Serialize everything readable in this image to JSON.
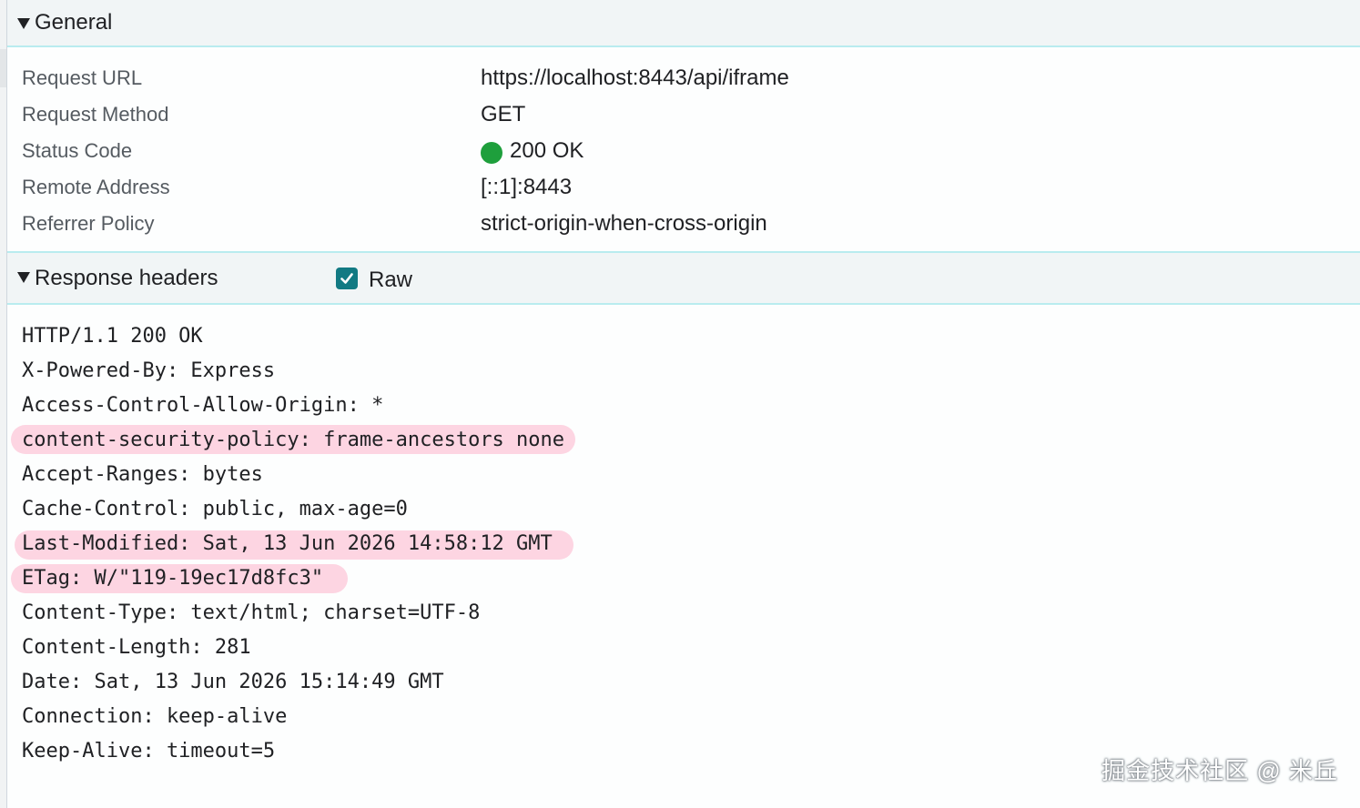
{
  "general": {
    "title": "General",
    "rows": [
      {
        "key": "Request URL",
        "value": "https://localhost:8443/api/iframe"
      },
      {
        "key": "Request Method",
        "value": "GET"
      },
      {
        "key": "Status Code",
        "value": "200 OK"
      },
      {
        "key": "Remote Address",
        "value": "[::1]:8443"
      },
      {
        "key": "Referrer Policy",
        "value": "strict-origin-when-cross-origin"
      }
    ],
    "status_color": "#1e9f3c"
  },
  "response_headers": {
    "title": "Response headers",
    "raw_label": "Raw",
    "raw_checked": true,
    "lines": [
      "HTTP/1.1 200 OK",
      "X-Powered-By: Express",
      "Access-Control-Allow-Origin: *",
      "content-security-policy: frame-ancestors none",
      "Accept-Ranges: bytes",
      "Cache-Control: public, max-age=0",
      "Last-Modified: Sat, 13 Jun 2026 14:58:12 GMT",
      "ETag: W/\"119-19ec17d8fc3\"",
      "Content-Type: text/html; charset=UTF-8",
      "Content-Length: 281",
      "Date: Sat, 13 Jun 2026 15:14:49 GMT",
      "Connection: keep-alive",
      "Keep-Alive: timeout=5"
    ],
    "highlighted": [
      3,
      6,
      7
    ],
    "highlight_color": "#fdd5e2"
  },
  "watermark": "掘金技术社区 @ 米丘",
  "colors": {
    "section_header_bg": "#f1f5f6",
    "section_border": "#b9ecef",
    "checkbox": "#127a83"
  },
  "icons": {
    "section_toggle": "triangle-down-icon",
    "raw_checkbox": "checkbox-checked-icon",
    "status": "status-dot-icon"
  }
}
